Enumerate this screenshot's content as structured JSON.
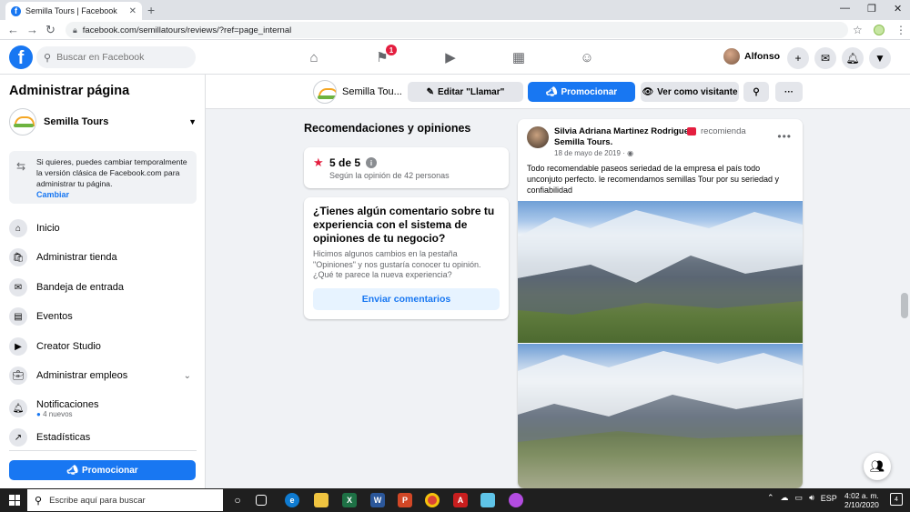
{
  "browser": {
    "tab_title": "Semilla Tours | Facebook",
    "new_tab": "+",
    "url": "facebook.com/semillatours/reviews/?ref=page_internal"
  },
  "fbnav": {
    "search_placeholder": "Buscar en Facebook",
    "notification_count": "1",
    "user_name": "Alfonso"
  },
  "sidebar": {
    "title": "Administrar página",
    "page_name": "Semilla Tours",
    "classic_text": "Si quieres, puedes cambiar temporalmente la versión clásica de Facebook.com para administrar tu página.",
    "classic_link": "Cambiar",
    "items": [
      {
        "label": "Inicio",
        "icon": "home-icon"
      },
      {
        "label": "Administrar tienda",
        "icon": "shop-icon"
      },
      {
        "label": "Bandeja de entrada",
        "icon": "inbox-icon"
      },
      {
        "label": "Eventos",
        "icon": "calendar-icon"
      },
      {
        "label": "Creator Studio",
        "icon": "creator-studio-icon"
      },
      {
        "label": "Administrar empleos",
        "icon": "briefcase-icon"
      },
      {
        "label": "Notificaciones",
        "sub": "4 nuevos",
        "icon": "bell-icon"
      },
      {
        "label": "Estadísticas",
        "icon": "stats-icon"
      }
    ],
    "promote_label": "Promocionar"
  },
  "page_header": {
    "page_name": "Semilla Tou...",
    "edit_label": "Editar \"Llamar\"",
    "promote_label": "Promocionar",
    "view_as_label": "Ver como visitante"
  },
  "reviews": {
    "section_title": "Recomendaciones y opiniones",
    "rating_value": "5 de 5",
    "rating_basis": "Según la opinión de 42 personas",
    "feedback_question": "¿Tienes algún comentario sobre tu experiencia con el sistema de opiniones de tu negocio?",
    "feedback_text": "Hicimos algunos cambios en la pestaña \"Opiniones\" y nos gustaría conocer tu opinión. ¿Qué te parece la nueva experiencia?",
    "feedback_button": "Enviar comentarios"
  },
  "post": {
    "author": "Silvia Adriana Martinez Rodriguez",
    "action": "recomienda",
    "page": "Semilla Tours.",
    "date": "18 de mayo de 2019 · ",
    "body": "Todo recomendable paseos seriedad de la empresa el país todo unconjuto perfecto. le recomendamos semillas Tour por su seriedad y confiabilidad"
  },
  "taskbar": {
    "search_placeholder": "Escribe aquí para buscar",
    "language": "ESP",
    "time": "4:02 a. m.",
    "date": "2/10/2020",
    "notification_count": "4"
  },
  "colors": {
    "fb_blue": "#1877f2",
    "badge_red": "#e41e3f",
    "light_blue": "#e7f3ff"
  }
}
